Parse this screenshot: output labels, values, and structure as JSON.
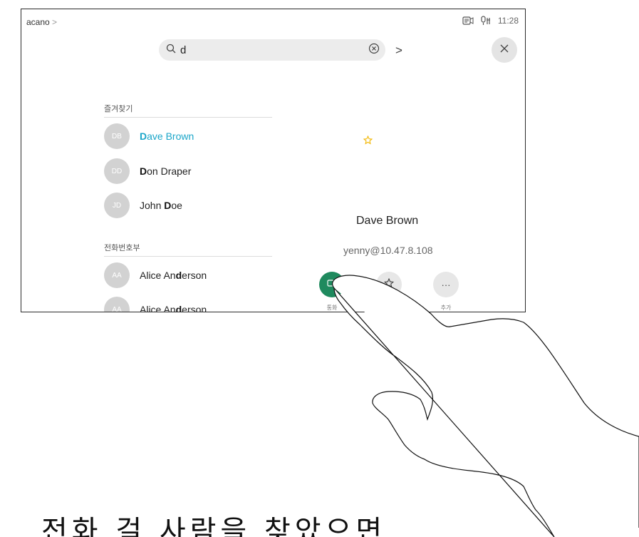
{
  "status": {
    "app_name": "acano",
    "chevron": ">",
    "time": "11:28"
  },
  "search": {
    "query": "d",
    "next": ">"
  },
  "sections": {
    "favorites": "즐겨찾기",
    "directory": "전화번호부"
  },
  "favorites": [
    {
      "initials": "DB",
      "pre": "",
      "bold": "D",
      "post": "ave Brown"
    },
    {
      "initials": "DD",
      "pre": "",
      "bold": "D",
      "post": "on Draper"
    },
    {
      "initials": "JD",
      "pre": "John ",
      "bold": "D",
      "post": "oe"
    }
  ],
  "directory": [
    {
      "initials": "AA",
      "pre": "Alice An",
      "bold": "d",
      "post": "erson"
    },
    {
      "initials": "AA",
      "pre": "Alice An",
      "bold": "d",
      "post": "erson"
    }
  ],
  "detail": {
    "name": "Dave Brown",
    "address": "yenny@10.47.8.108",
    "call_label": "통화",
    "more_label": "추가",
    "more_glyph": "···"
  },
  "caption": "전화 걸 사람을 찾았으면",
  "colors": {
    "accent": "#1ba6c9",
    "call_green": "#1f8a5e",
    "star": "#f2b600"
  }
}
